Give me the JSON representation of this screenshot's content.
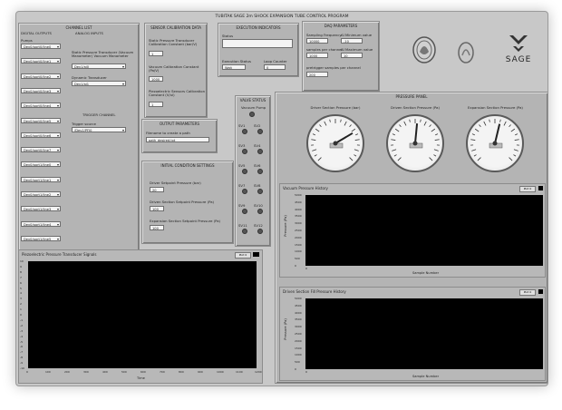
{
  "app_title": "TUBITAK SAGE 2m SHOCK EXPANSION TUBE CONTROL PROGRAM",
  "channel_list": {
    "title": "CHANNEL LIST",
    "digital_outputs_label": "DIGITAL OUTPUTS",
    "pumps_label": "Pumps",
    "digital_rows": [
      "Dev0/port0/line0",
      "Dev0/port0/line1",
      "Dev0/port0/line2",
      "Dev0/port0/line3",
      "Dev0/port0/line4",
      "Dev0/port0/line5",
      "Dev0/port0/line6",
      "Dev0/port0/line7",
      "Dev0/port1/line0",
      "Dev0/port1/line1",
      "Dev0/port1/line2",
      "Dev0/port1/line3",
      "Dev0/port1/line4",
      "Dev0/port1/line5"
    ],
    "analog_inputs_label": "ANALOG INPUTS",
    "static_pressure_label": "Static Pressure Transducer (Vacuum Manometer) Vacuum Manometer",
    "static_pressure_value": "Dev1/ai0",
    "dynamic_label": "Dynamic Transducer",
    "dynamic_value": "Dev1/ai1",
    "trigger_channel_title": "TRIGGER CHANNEL",
    "trigger_source_label": "Trigger source",
    "trigger_source_value": "/Dev1/PFI0"
  },
  "sensor_calibration": {
    "title": "SENSOR CALIBRATION DATA",
    "static_label": "Static Pressure Transducer Calibration Constant (bar/V)",
    "static_value": "1",
    "vacuum_label": "Vacuum Calibration Constant (Pa/V)",
    "vacuum_value": "1000",
    "piezo_label": "Piezoelectric Sensors Calibration Constant (V/ui)",
    "piezo_value": "1"
  },
  "execution": {
    "title": "EXECUTION INDICATORS",
    "status_label": "Status",
    "status_value": "",
    "execution_status_label": "Execution Status",
    "execution_status_value": "Wait",
    "loop_counter_label": "Loop Counter",
    "loop_counter_value": "0"
  },
  "daq": {
    "title": "DAQ PARAMETERS",
    "sampling_label": "Sampling Frequency",
    "sampling_value": "10000",
    "samples_label": "samples per channel",
    "samples_value": "1000",
    "min_label": "AI Minimum value",
    "min_value": "-10",
    "max_label": "AI Maximum value",
    "max_value": "10",
    "pretrig_label": "pretrigger samples per channel",
    "pretrig_value": "200"
  },
  "logos": {
    "logo1": "seal-logo",
    "logo2": "emblem-logo",
    "sage_text": "SAGE"
  },
  "output_params": {
    "title": "OUTPUT PARAMETERS",
    "file_label": "Filename to create a path",
    "file_value": "path_desired.txt"
  },
  "initial_conditions": {
    "title": "INITIAL CONDITION SETTINGS",
    "driver_label": "Driver Setpoint Pressure (bar)",
    "driver_value": "20",
    "driven_label": "Driven Section Setpoint Pressure (Pa)",
    "driven_value": "100",
    "expansion_label": "Expansion Section Setpoint Pressure (Pa)",
    "expansion_value": "100"
  },
  "valve_status": {
    "title": "VALVE STATUS",
    "vacuum_pump_label": "Vacuum Pump",
    "led_labels": [
      "SV1",
      "SV2",
      "SV3",
      "SV4",
      "SV5",
      "SV6",
      "SV7",
      "SV8",
      "SV9",
      "SV10",
      "SV11",
      "SV12"
    ]
  },
  "pressure_panel": {
    "title": "PRESSURE PANEL",
    "gauges": [
      {
        "label": "Driver Section Pressure (bar)",
        "value_fraction": 0.72
      },
      {
        "label": "Driven Section Pressure (Pa)",
        "value_fraction": 0.52
      },
      {
        "label": "Expansion Section Pressure (Pa)",
        "value_fraction": 0.55
      }
    ]
  },
  "vacuum_history": {
    "title": "Vacuum Pressure History",
    "ylabel": "Pressure (Pa)",
    "xlabel": "Sample Number",
    "plot_button": "Plot 0",
    "yticks": [
      "5000",
      "4500",
      "4000",
      "3500",
      "3000",
      "2500",
      "2000",
      "1500",
      "1000",
      "500",
      "0"
    ],
    "xticks": [
      "0"
    ]
  },
  "driven_history": {
    "title": "Driven Section Fill Pressure History",
    "ylabel": "Pressure (Pa)",
    "xlabel": "Sample Number",
    "plot_button": "Plot 0",
    "yticks": [
      "5000",
      "4500",
      "4000",
      "3500",
      "3000",
      "2500",
      "2000",
      "1500",
      "1000",
      "500",
      "0"
    ],
    "xticks": [
      "0"
    ]
  },
  "piezo_graph": {
    "title": "Piezoelectric Pressure Transducer Signals",
    "plot_button": "Plot 0",
    "xlabel": "Time",
    "yticks": [
      "10",
      "9",
      "8",
      "7",
      "6",
      "5",
      "4",
      "3",
      "2",
      "1",
      "0",
      "-1",
      "-2",
      "-3",
      "-4",
      "-5",
      "-6",
      "-7",
      "-8",
      "-9",
      "-10"
    ],
    "xticks": [
      "0",
      "100",
      "200",
      "300",
      "400",
      "500",
      "600",
      "700",
      "800",
      "900",
      "1000",
      "1100",
      "1200"
    ]
  }
}
